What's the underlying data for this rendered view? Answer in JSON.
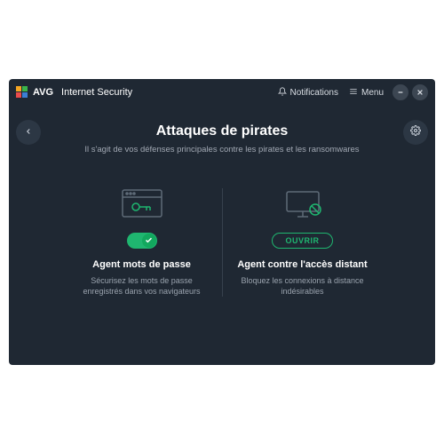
{
  "brand": {
    "name": "AVG",
    "product": "Internet Security"
  },
  "titlebar": {
    "notifications": "Notifications",
    "menu": "Menu"
  },
  "page": {
    "title": "Attaques de pirates",
    "subtitle": "Il s'agit de vos défenses principales contre les pirates et les ransomwares"
  },
  "cards": [
    {
      "title": "Agent mots de passe",
      "desc": "Sécurisez les mots de passe enregistrés dans vos navigateurs",
      "toggle_on": true
    },
    {
      "title": "Agent contre l'accès distant",
      "desc": "Bloquez les connexions à distance indésirables",
      "button_label": "OUVRIR"
    }
  ],
  "colors": {
    "accent": "#1fb670",
    "bg": "#1f2833"
  }
}
